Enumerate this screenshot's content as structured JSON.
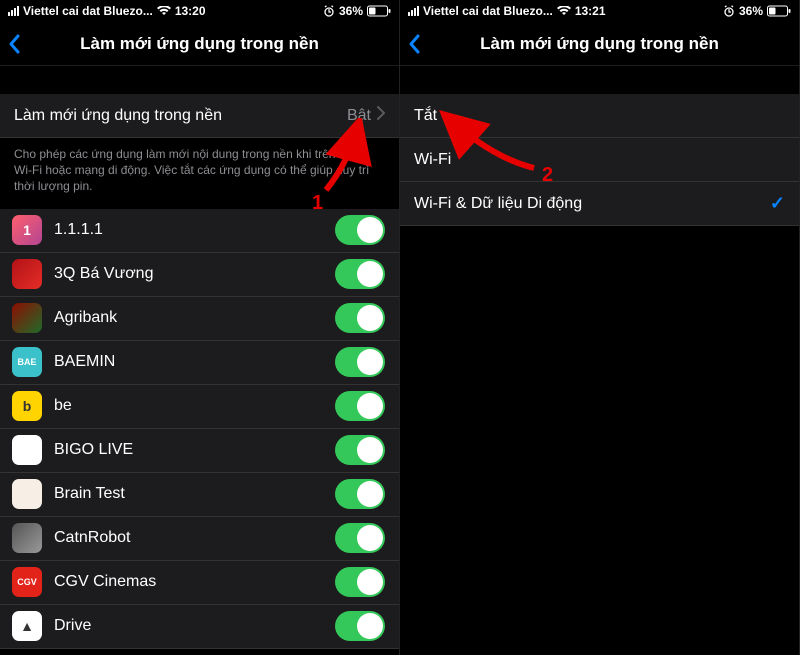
{
  "left": {
    "status": {
      "carrier": "Viettel cai dat Bluezo...",
      "time": "13:20",
      "battery": "36%"
    },
    "title": "Làm mới ứng dụng trong nền",
    "setting": {
      "label": "Làm mới ứng dụng trong nền",
      "value": "Bật"
    },
    "footer": "Cho phép các ứng dụng làm mới nội dung trong nền khi trên mạng Wi-Fi hoặc mạng di động. Việc tắt các ứng dụng có thể giúp duy trì thời lượng pin.",
    "apps": [
      {
        "name": "1.1.1.1",
        "icon_bg": "linear-gradient(135deg,#ff5f6d,#b24592)",
        "icon_text": "1"
      },
      {
        "name": "3Q Bá Vương",
        "icon_bg": "linear-gradient(135deg,#b31217,#e52d27)",
        "icon_text": ""
      },
      {
        "name": "Agribank",
        "icon_bg": "linear-gradient(135deg,#8e0e00,#1f6b2a)",
        "icon_text": ""
      },
      {
        "name": "BAEMIN",
        "icon_bg": "#3ac1c9",
        "icon_text": "BAE"
      },
      {
        "name": "be",
        "icon_bg": "#ffd400",
        "icon_text": "b"
      },
      {
        "name": "BIGO LIVE",
        "icon_bg": "#ffffff",
        "icon_text": ""
      },
      {
        "name": "Brain Test",
        "icon_bg": "#f7efe6",
        "icon_text": ""
      },
      {
        "name": "CatnRobot",
        "icon_bg": "linear-gradient(135deg,#555,#999)",
        "icon_text": ""
      },
      {
        "name": "CGV Cinemas",
        "icon_bg": "#e2231a",
        "icon_text": "CGV"
      },
      {
        "name": "Drive",
        "icon_bg": "#ffffff",
        "icon_text": "▲"
      }
    ],
    "annot": "1"
  },
  "right": {
    "status": {
      "carrier": "Viettel cai dat Bluezo...",
      "time": "13:21",
      "battery": "36%"
    },
    "title": "Làm mới ứng dụng trong nền",
    "options": [
      {
        "label": "Tắt",
        "checked": false
      },
      {
        "label": "Wi-Fi",
        "checked": false
      },
      {
        "label": "Wi-Fi & Dữ liệu Di động",
        "checked": true
      }
    ],
    "annot": "2"
  }
}
